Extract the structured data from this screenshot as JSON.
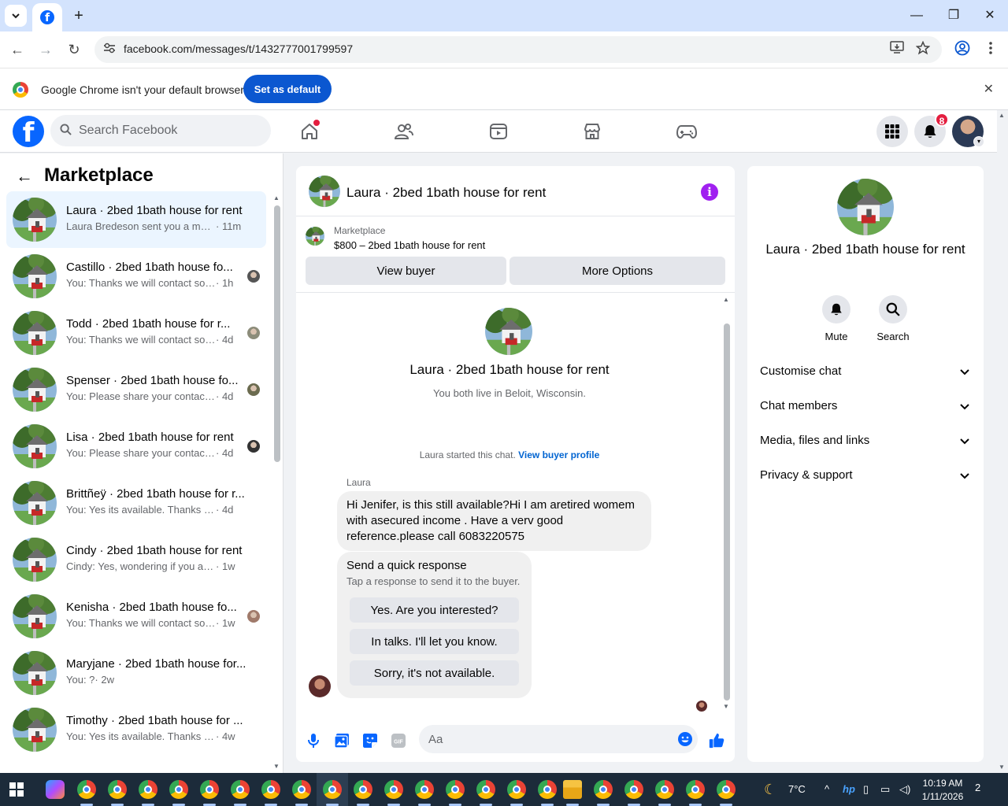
{
  "browser": {
    "url": "facebook.com/messages/t/1432777001799597",
    "infobar_text": "Google Chrome isn't your default browser",
    "set_default_label": "Set as default",
    "close_glyph": "✕",
    "new_tab_glyph": "+",
    "minimize_glyph": "—",
    "restore_glyph": "❐",
    "window_close_glyph": "✕",
    "back_glyph": "←",
    "forward_glyph": "→",
    "reload_glyph": "↻"
  },
  "header": {
    "logo_letter": "f",
    "search_placeholder": "Search Facebook",
    "notification_count": "8",
    "brand_color": "#0866ff"
  },
  "sidebar": {
    "back_glyph": "←",
    "title": "Marketplace",
    "conversations": [
      {
        "name": "Laura · 2bed 1bath house for rent",
        "preview": "Laura Bredeson sent you a messa...",
        "time": "· 11m",
        "active": true
      },
      {
        "name": "Castillo · 2bed 1bath house fo...",
        "preview": "You: Thanks we will contact soo...",
        "time": "· 1h"
      },
      {
        "name": "Todd · 2bed 1bath house for r...",
        "preview": "You: Thanks we will contact soo...",
        "time": "· 4d"
      },
      {
        "name": "Spenser · 2bed 1bath house fo...",
        "preview": "You: Please share your contact n...",
        "time": "· 4d"
      },
      {
        "name": "Lisa · 2bed 1bath house for rent",
        "preview": "You: Please share your contact n...",
        "time": "· 4d"
      },
      {
        "name": "Brittñeÿ · 2bed 1bath house for r...",
        "preview": "You: Yes its available. Thanks for rea...",
        "time": "· 4d"
      },
      {
        "name": "Cindy · 2bed 1bath house for rent",
        "preview": "Cindy: Yes, wondering if you allow ...",
        "time": "· 1w"
      },
      {
        "name": "Kenisha · 2bed 1bath house fo...",
        "preview": "You: Thanks we will contact soo...",
        "time": "· 1w"
      },
      {
        "name": "Maryjane · 2bed 1bath house for...",
        "preview": "You: ?",
        "time": "· 2w"
      },
      {
        "name": "Timothy · 2bed 1bath house for ...",
        "preview": "You: Yes its available. Thanks for re...",
        "time": "· 4w"
      }
    ]
  },
  "chat": {
    "title": "Laura · 2bed 1bath house for rent",
    "info_glyph": "i",
    "listing_label": "Marketplace",
    "listing_title": "$800 – 2bed 1bath house for rent",
    "view_buyer_label": "View buyer",
    "more_options_label": "More Options",
    "intro_name": "Laura · 2bed 1bath house for rent",
    "intro_location": "You both live in Beloit, Wisconsin.",
    "started_text": "Laura started this chat.",
    "view_profile_link": "View buyer profile",
    "sender_name": "Laura",
    "message_line1": "Hi Jenifer, is this still available?Hi I am aretired womem",
    "message_line2": "with asecured income . Have a verv good",
    "message_line3": "reference.please call 6083220575",
    "quick_title": "Send a quick response",
    "quick_subtitle": "Tap a response to send it to the buyer.",
    "quick_responses": [
      "Yes. Are you interested?",
      "In talks. I'll let you know.",
      "Sorry, it's not available."
    ],
    "composer_placeholder": "Aa",
    "accent_color": "#0866ff"
  },
  "details": {
    "name": "Laura · 2bed 1bath house for rent",
    "mute_label": "Mute",
    "search_label": "Search",
    "sections": [
      "Customise chat",
      "Chat members",
      "Media, files and links",
      "Privacy & support"
    ]
  },
  "taskbar": {
    "temperature": "7°C",
    "time": "10:19 AM",
    "date": "1/11/2026",
    "notification_count": "2"
  }
}
